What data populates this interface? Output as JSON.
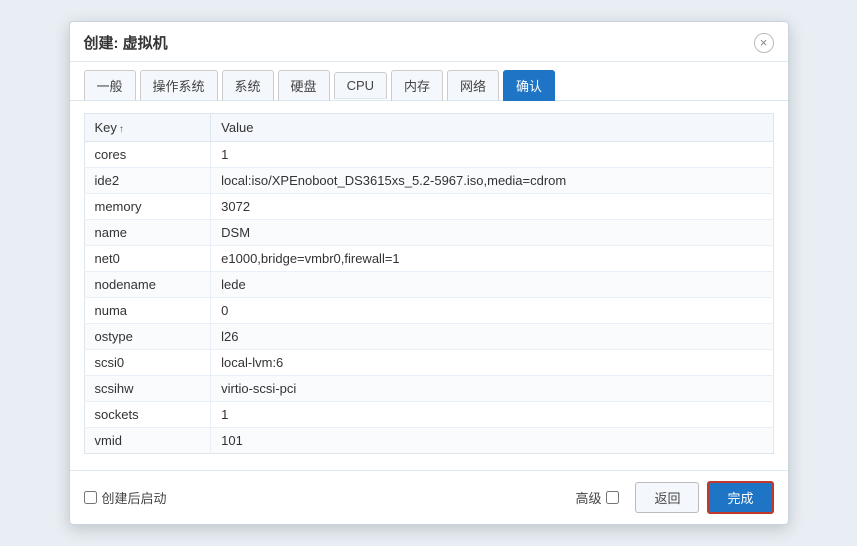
{
  "dialog": {
    "title": "创建: 虚拟机",
    "close_label": "×"
  },
  "tabs": [
    {
      "label": "一般",
      "active": false
    },
    {
      "label": "操作系统",
      "active": false
    },
    {
      "label": "系统",
      "active": false
    },
    {
      "label": "硬盘",
      "active": false
    },
    {
      "label": "CPU",
      "active": false
    },
    {
      "label": "内存",
      "active": false
    },
    {
      "label": "网络",
      "active": false
    },
    {
      "label": "确认",
      "active": true
    }
  ],
  "table": {
    "col_key": "Key",
    "col_key_sort": "↑",
    "col_value": "Value",
    "rows": [
      {
        "key": "cores",
        "value": "1"
      },
      {
        "key": "ide2",
        "value": "local:iso/XPEnoboot_DS3615xs_5.2-5967.iso,media=cdrom"
      },
      {
        "key": "memory",
        "value": "3072"
      },
      {
        "key": "name",
        "value": "DSM"
      },
      {
        "key": "net0",
        "value": "e1000,bridge=vmbr0,firewall=1"
      },
      {
        "key": "nodename",
        "value": "lede"
      },
      {
        "key": "numa",
        "value": "0"
      },
      {
        "key": "ostype",
        "value": "l26"
      },
      {
        "key": "scsi0",
        "value": "local-lvm:6"
      },
      {
        "key": "scsihw",
        "value": "virtio-scsi-pci"
      },
      {
        "key": "sockets",
        "value": "1"
      },
      {
        "key": "vmid",
        "value": "101"
      }
    ]
  },
  "footer": {
    "checkbox_label": "创建后启动",
    "advanced_label": "高级",
    "back_btn": "返回",
    "finish_btn": "完成"
  }
}
